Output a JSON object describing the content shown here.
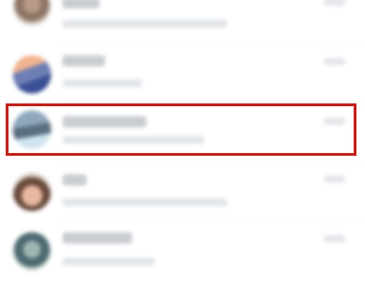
{
  "colors": {
    "background": "#ffffff",
    "highlight_border": "#c4231d"
  },
  "conversations": [
    {
      "avatar": "avatar-icon",
      "name": "",
      "preview": "",
      "time": ""
    },
    {
      "avatar": "avatar-icon",
      "name": "",
      "preview": "",
      "time": ""
    },
    {
      "avatar": "avatar-icon",
      "name": "",
      "preview": "",
      "time": "",
      "highlighted": true
    },
    {
      "avatar": "avatar-icon",
      "name": "",
      "preview": "",
      "time": ""
    },
    {
      "avatar": "avatar-icon",
      "name": "",
      "preview": "",
      "time": ""
    }
  ]
}
